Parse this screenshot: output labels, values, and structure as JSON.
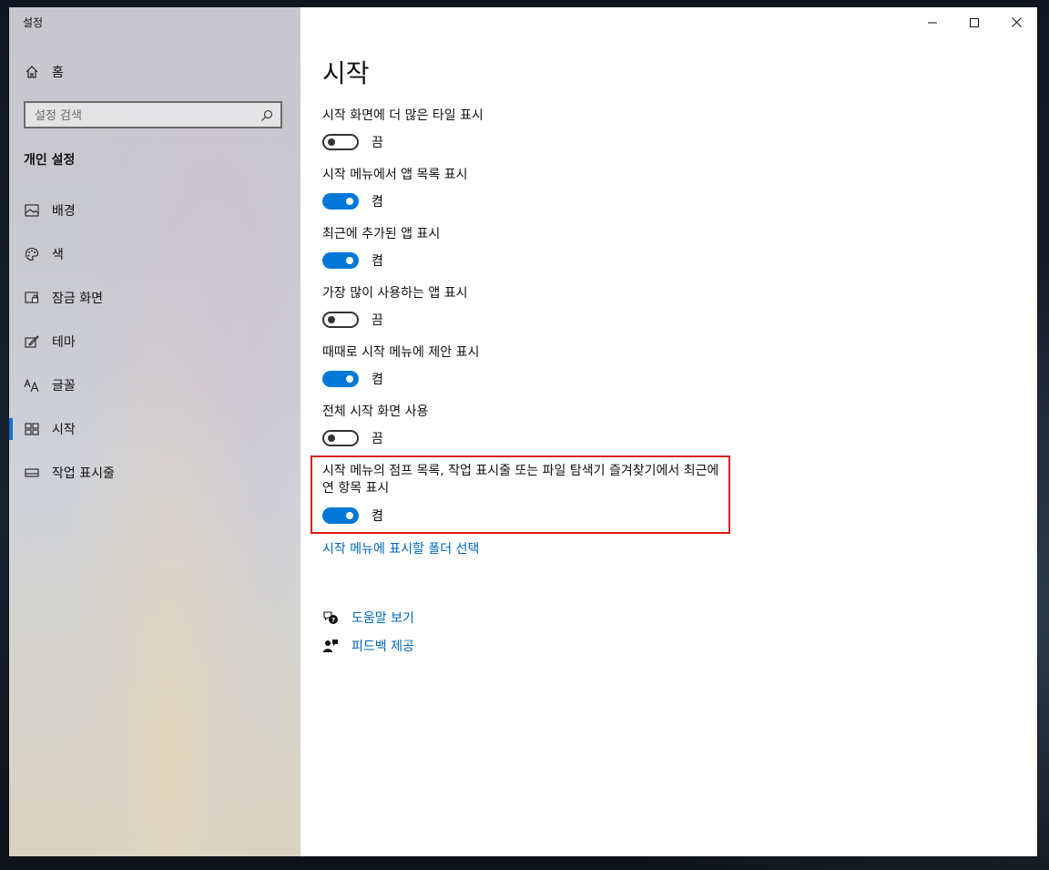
{
  "window": {
    "app_title": "설정",
    "caption": {
      "minimize_icon": "minimize-icon",
      "maximize_icon": "maximize-icon",
      "close_icon": "close-icon"
    }
  },
  "sidebar": {
    "home_label": "홈",
    "search_placeholder": "설정 검색",
    "section_heading": "개인 설정",
    "items": [
      {
        "label": "배경",
        "icon": "picture-icon"
      },
      {
        "label": "색",
        "icon": "palette-icon"
      },
      {
        "label": "잠금 화면",
        "icon": "lock-screen-icon"
      },
      {
        "label": "테마",
        "icon": "theme-icon"
      },
      {
        "label": "글꼴",
        "icon": "font-icon"
      },
      {
        "label": "시작",
        "icon": "start-icon",
        "active": true
      },
      {
        "label": "작업 표시줄",
        "icon": "taskbar-icon"
      }
    ]
  },
  "main": {
    "title": "시작",
    "settings": [
      {
        "label": "시작 화면에 더 많은 타일 표시",
        "state": "끔",
        "on": false
      },
      {
        "label": "시작 메뉴에서 앱 목록 표시",
        "state": "켬",
        "on": true
      },
      {
        "label": "최근에 추가된 앱 표시",
        "state": "켬",
        "on": true
      },
      {
        "label": "가장 많이 사용하는 앱 표시",
        "state": "끔",
        "on": false
      },
      {
        "label": "때때로 시작 메뉴에 제안 표시",
        "state": "켬",
        "on": true
      },
      {
        "label": "전체 시작 화면 사용",
        "state": "끔",
        "on": false
      },
      {
        "label": "시작 메뉴의 점프 목록, 작업 표시줄 또는 파일 탐색기 즐겨찾기에서 최근에 연 항목 표시",
        "state": "켬",
        "on": true
      }
    ],
    "folder_link": "시작 메뉴에 표시할 폴더 선택",
    "help_link": "도움말 보기",
    "feedback_link": "피드백 제공"
  },
  "colors": {
    "accent": "#0078d7",
    "link": "#0067c0",
    "highlight": "#e01919"
  }
}
